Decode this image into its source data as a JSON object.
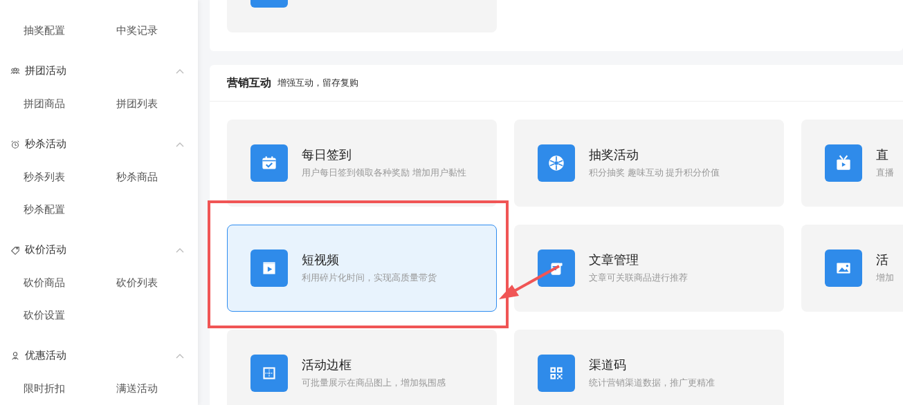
{
  "sidebar": {
    "groups": [
      {
        "items": [
          "抽奖配置",
          "中奖记录"
        ]
      },
      {
        "title": "拼团活动",
        "expanded": true,
        "items": [
          "拼团商品",
          "拼团列表"
        ]
      },
      {
        "title": "秒杀活动",
        "expanded": true,
        "items": [
          "秒杀列表",
          "秒杀商品",
          "秒杀配置"
        ]
      },
      {
        "title": "砍价活动",
        "expanded": true,
        "items": [
          "砍价商品",
          "砍价列表",
          "砍价设置"
        ]
      },
      {
        "title": "优惠活动",
        "expanded": true,
        "items": [
          "限时折扣",
          "满送活动"
        ]
      }
    ]
  },
  "marketing": {
    "title": "营销互动",
    "subtitle": "增强互动，留存复购",
    "cards": [
      {
        "title": "每日签到",
        "description": "用户每日签到领取各种奖励 增加用户黏性",
        "selected": false
      },
      {
        "title": "抽奖活动",
        "description": "积分抽奖 趣味互动 提升积分价值",
        "selected": false
      },
      {
        "title": "直",
        "description": "直播",
        "selected": false
      },
      {
        "title": "短视频",
        "description": "利用碎片化时间，实现高质量带货",
        "selected": true
      },
      {
        "title": "文章管理",
        "description": "文章可关联商品进行推荐",
        "selected": false
      },
      {
        "title": "活",
        "description": "增加",
        "selected": false
      },
      {
        "title": "活动边框",
        "description": "可批量展示在商品图上，增加氛围感",
        "selected": false
      },
      {
        "title": "渠道码",
        "description": "统计营销渠道数据，推广更精准",
        "selected": false
      }
    ]
  }
}
